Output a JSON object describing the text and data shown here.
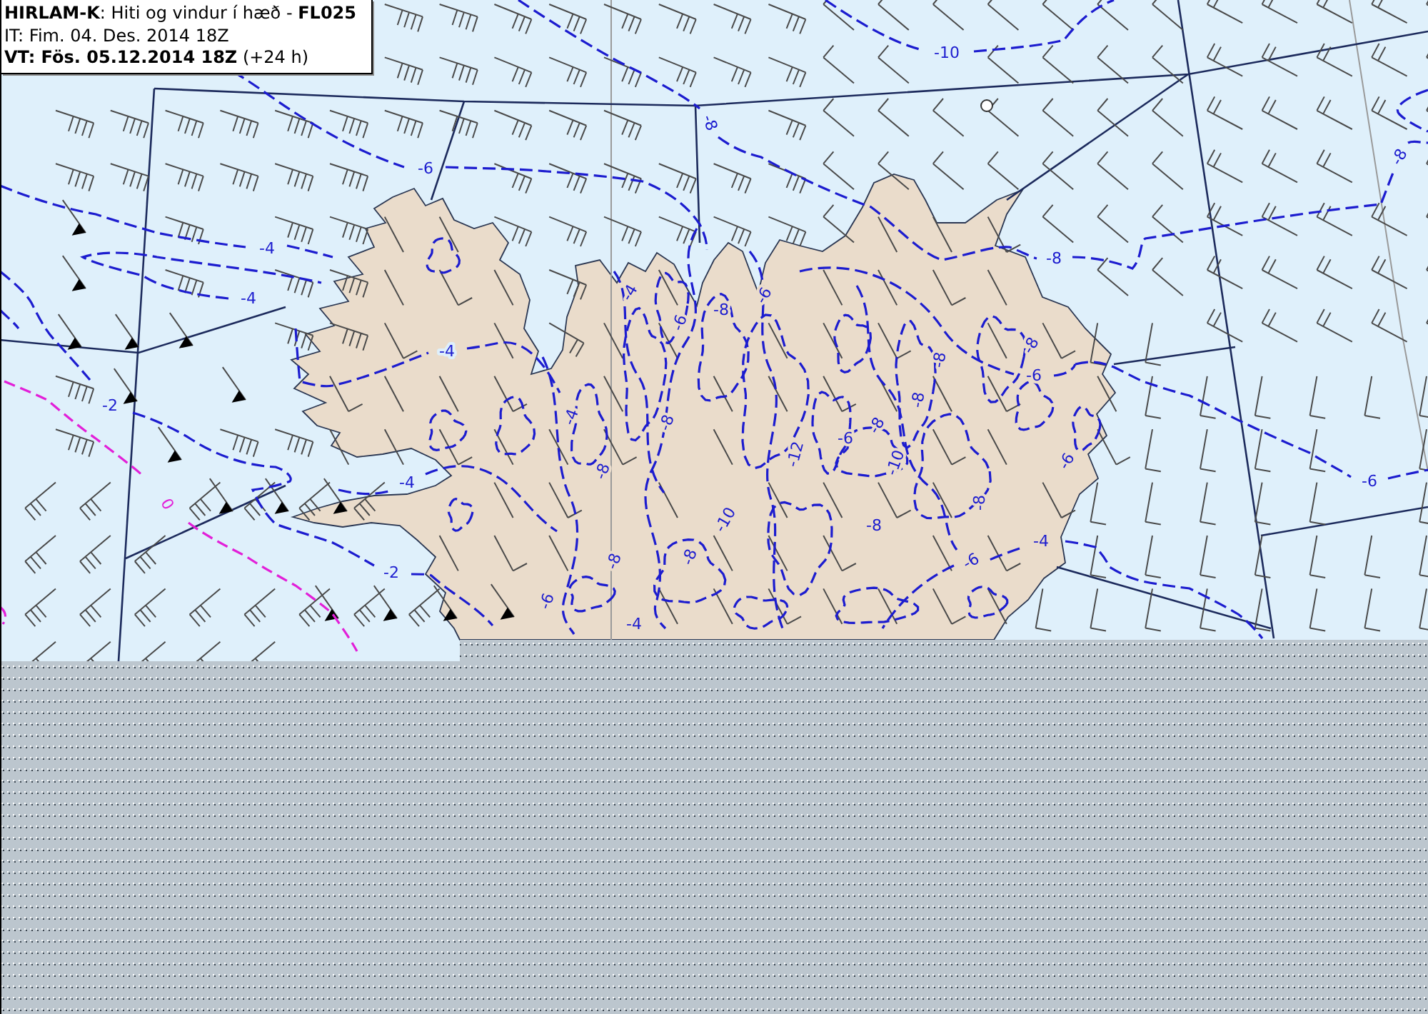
{
  "title_box": {
    "title": "**HIRLAM-K**: Hiti og vindur í hæð - **FL025**",
    "issue_time": "IT: Fim. 04. Des. 2014 18Z",
    "valid_time": "**VT: Fös. 05.12.2014 18Z** (+24 h)"
  },
  "map": {
    "isotherm_labels": [
      "-10",
      "-8",
      "-6",
      "-4",
      "-4",
      "-8",
      "-8",
      "-6",
      "-4",
      "-6",
      "-6",
      "-8",
      "-8",
      "-6",
      "-6",
      "-8",
      "-10",
      "-12",
      "-8",
      "-10",
      "-8",
      "-8",
      "-4",
      "-2",
      "-4",
      "-2",
      "-4",
      "-8",
      "-8",
      "-8",
      "-8",
      "-6",
      "-4",
      "-4",
      "-6",
      "-6",
      "-8"
    ],
    "freezing_level_label": "0"
  }
}
